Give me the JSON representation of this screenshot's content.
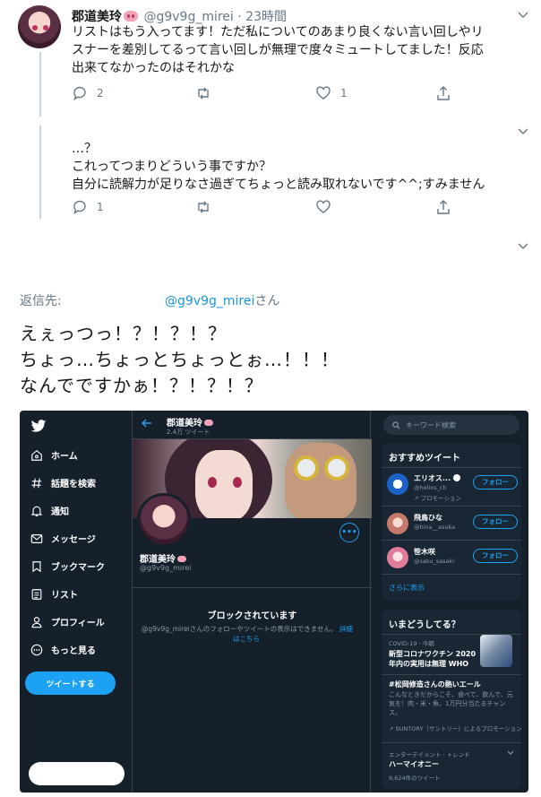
{
  "tweet1": {
    "name": "郡道美玲",
    "handle": "@g9v9g_mirei",
    "time": "· 23時間",
    "lines": [
      "リストはもう入ってます！ただ私についてのあまり良くない言い回しやリ",
      "スナーを差別してるって言い回しが無理で度々ミュートしてました！反応",
      "出来てなかったのはそれかな"
    ],
    "reply_count": "2",
    "retweet_count": "",
    "like_count": "1"
  },
  "tweet2": {
    "lines": [
      "…？",
      "これってつまりどういう事ですか？",
      "自分に読解力が足りなさ過ぎてちょっと読み取れないです^^;すみません"
    ],
    "reply_count": "1",
    "retweet_count": "",
    "like_count": ""
  },
  "reply_to": {
    "label": "返信先:",
    "handle": "@g9v9g_mirei",
    "suffix": "さん"
  },
  "main_text": "えぇっつっ！？！？！？\nちょっ…ちょっとちょっとぉ…！！！\nなんでですかぁ！？！？！？",
  "embedded": {
    "nav": [
      {
        "label": "ホーム",
        "icon": "home-icon"
      },
      {
        "label": "話題を検索",
        "icon": "hashtag-icon"
      },
      {
        "label": "通知",
        "icon": "bell-icon"
      },
      {
        "label": "メッセージ",
        "icon": "mail-icon"
      },
      {
        "label": "ブックマーク",
        "icon": "bookmark-icon"
      },
      {
        "label": "リスト",
        "icon": "list-icon"
      },
      {
        "label": "プロフィール",
        "icon": "person-icon"
      },
      {
        "label": "もっと見る",
        "icon": "more-circle-icon"
      }
    ],
    "tweet_button": "ツイートする",
    "profile": {
      "title": "郡道美玲",
      "tweet_count": "2.4万 ツイート",
      "name": "郡道美玲",
      "handle": "@g9v9g_mirei",
      "more_button": "•••"
    },
    "blocked": {
      "title": "ブロックされています",
      "text": "@g9v9g_mireiさんのフォローやツイートの表示はできません。",
      "link1": "詳細",
      "link2": "はこちら"
    },
    "search_placeholder": "キーワード検索",
    "recommend": {
      "title": "おすすめツイート",
      "users": [
        {
          "name": "エリオス...",
          "handle": "@helios_ch",
          "extra": "プロモーション"
        },
        {
          "name": "飛鳥ひな",
          "handle": "@hina__asuka",
          "extra": ""
        },
        {
          "name": "笹木咲",
          "handle": "@saku_sasaki",
          "extra": ""
        }
      ],
      "follow_label": "フォロー",
      "show_more": "さらに表示"
    },
    "trends": {
      "title": "いまどうしてる？",
      "items": [
        {
          "meta": "COVID-19 · 今朝",
          "title1": "新型コロナワクチン 2020",
          "title2": "年内の実用は無理 WHO"
        },
        {
          "title1": "#松岡修造さんの熱いエール",
          "desc": "こんなときだからこそ、食べて、飲んで、元気を！肉・米・魚、1万円分当たるチャンス。",
          "promo": "SUNTORY（サントリー）によるプロモーション"
        },
        {
          "meta": "エンターテイメント · トレンド",
          "title1": "ハーマイオニー",
          "count": "9,624件のツイート"
        }
      ]
    }
  },
  "colors": {
    "accent": "#1da1f2",
    "dark_bg": "#15202b",
    "card_bg": "#192734",
    "muted": "#657786"
  }
}
